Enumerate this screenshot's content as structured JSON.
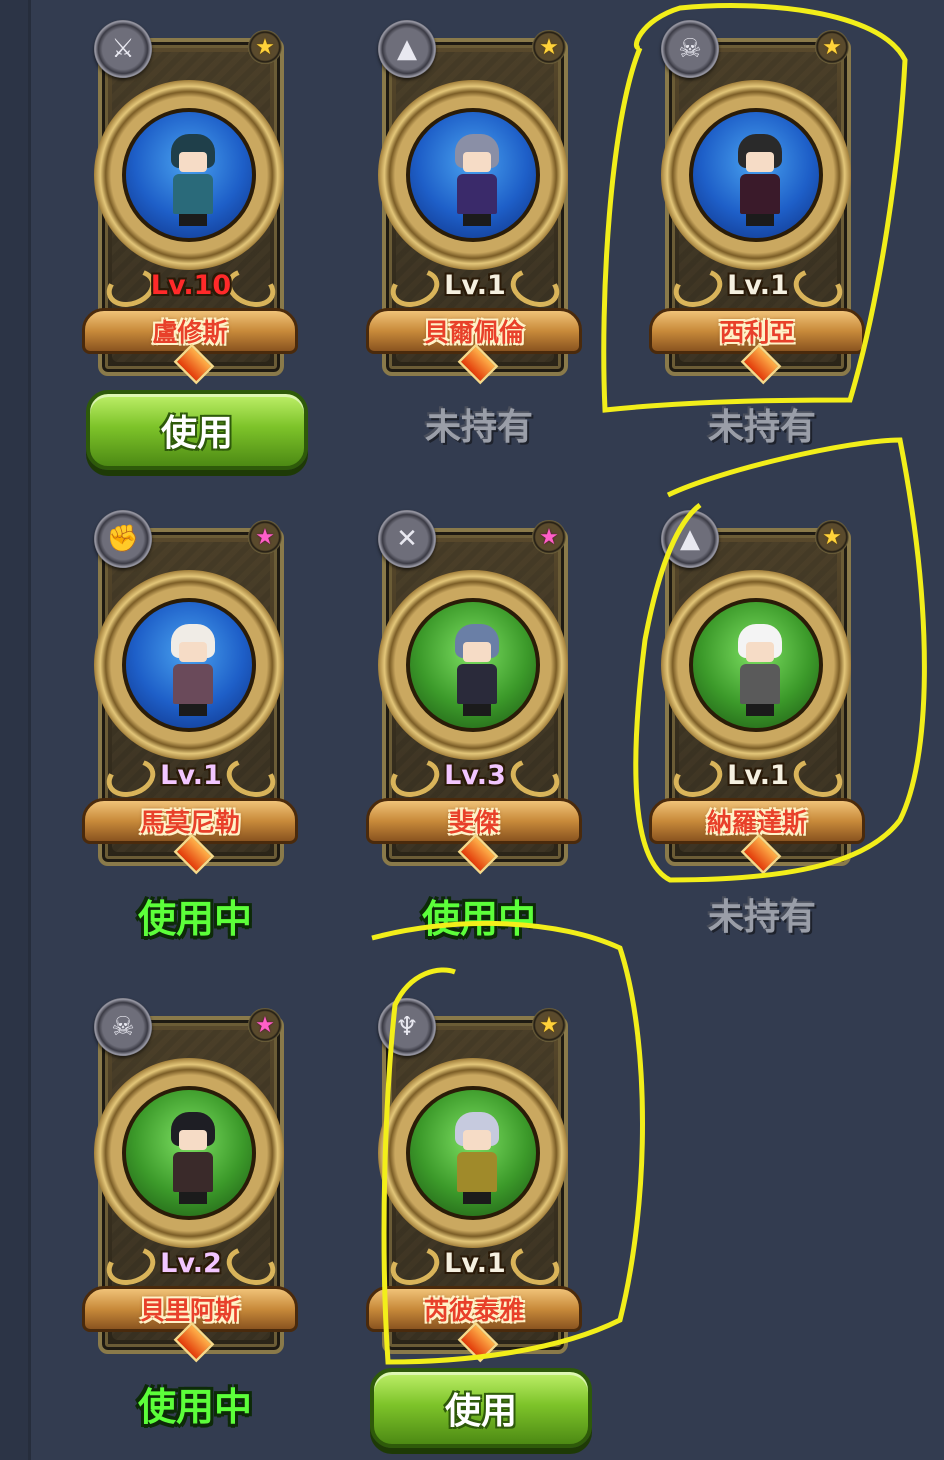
{
  "cards": [
    {
      "level": "Lv.10",
      "level_color": "red",
      "name": "盧修斯",
      "badge_icon": "axe-icon",
      "badge_glyph": "⚔",
      "star": "gold",
      "bg": "blue",
      "hair": "#1f3f4a",
      "body": "#2a6a7a",
      "status_type": "button",
      "status": "使用"
    },
    {
      "level": "Lv.1",
      "level_color": "white",
      "name": "貝爾佩倫",
      "badge_icon": "witch-hat-icon",
      "badge_glyph": "▲",
      "star": "gold",
      "bg": "blue",
      "hair": "#8a8fa6",
      "body": "#3a2a6a",
      "status_type": "unowned",
      "status": "未持有"
    },
    {
      "level": "Lv.1",
      "level_color": "white",
      "name": "西利亞",
      "badge_icon": "skull-icon",
      "badge_glyph": "☠",
      "star": "gold",
      "bg": "blue",
      "hair": "#2a2a2a",
      "body": "#3a1a2a",
      "status_type": "unowned",
      "status": "未持有"
    },
    {
      "level": "Lv.1",
      "level_color": "pink",
      "name": "馬莫尼勒",
      "badge_icon": "fist-icon",
      "badge_glyph": "✊",
      "star": "pink",
      "bg": "blue",
      "hair": "#f0ece6",
      "body": "#6a4a5a",
      "status_type": "inuse",
      "status": "使用中"
    },
    {
      "level": "Lv.3",
      "level_color": "pink",
      "name": "斐傑",
      "badge_icon": "shield-swords-icon",
      "badge_glyph": "✕",
      "star": "pink",
      "bg": "green",
      "hair": "#6a7fa6",
      "body": "#2a2a3a",
      "status_type": "inuse",
      "status": "使用中"
    },
    {
      "level": "Lv.1",
      "level_color": "white",
      "name": "納羅達斯",
      "badge_icon": "witch-hat-icon",
      "badge_glyph": "▲",
      "star": "gold",
      "bg": "green",
      "hair": "#f4f4f4",
      "body": "#5a5a5a",
      "status_type": "unowned",
      "status": "未持有"
    },
    {
      "level": "Lv.2",
      "level_color": "pink",
      "name": "貝里阿斯",
      "badge_icon": "skull-icon",
      "badge_glyph": "☠",
      "star": "pink",
      "bg": "green",
      "hair": "#1e1e24",
      "body": "#3a2a2a",
      "status_type": "inuse",
      "status": "使用中"
    },
    {
      "level": "Lv.1",
      "level_color": "white",
      "name": "芮彼泰雅",
      "badge_icon": "wings-icon",
      "badge_glyph": "♆",
      "star": "gold",
      "bg": "green",
      "hair": "#c6cade",
      "body": "#a08a2a",
      "status_type": "button",
      "status": "使用"
    }
  ],
  "annotations": {
    "color": "#f2ee1a"
  }
}
